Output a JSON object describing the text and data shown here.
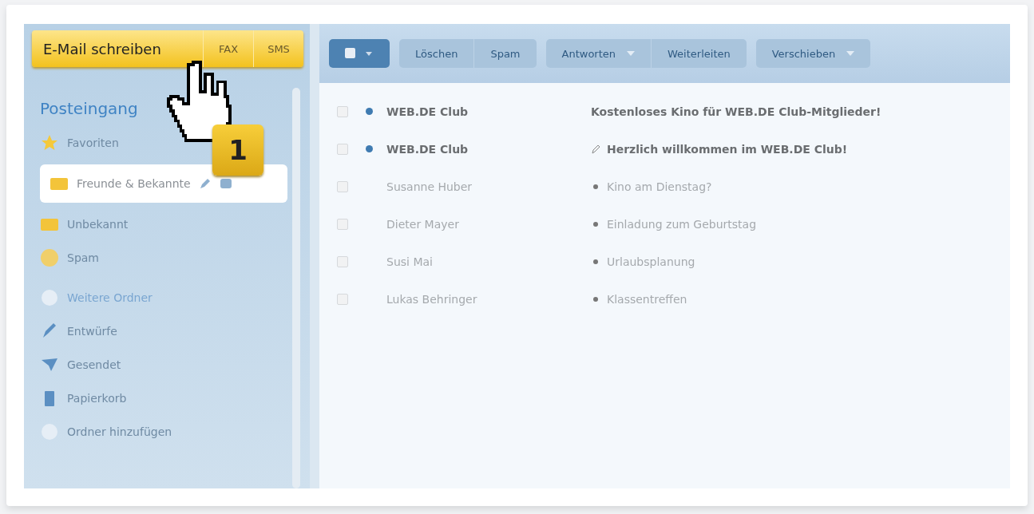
{
  "compose": {
    "buttons": [
      {
        "label": "E-Mail schreiben",
        "kind": "primary"
      },
      {
        "label": "FAX",
        "kind": "secondary"
      },
      {
        "label": "SMS",
        "kind": "secondary"
      }
    ]
  },
  "step_badge": {
    "label": "1"
  },
  "sidebar": {
    "items": [
      {
        "kind": "heading",
        "label": "Posteingang"
      },
      {
        "kind": "favorites",
        "label": "Favoriten",
        "selected": false
      },
      {
        "kind": "folder",
        "label": "Freunde & Bekannte",
        "selected": true
      },
      {
        "kind": "folder",
        "label": "Unbekannt",
        "selected": false
      },
      {
        "kind": "spam",
        "label": "Spam",
        "selected": false
      },
      {
        "kind": "group",
        "label": "Weitere Ordner"
      },
      {
        "kind": "drafts",
        "label": "Entwürfe",
        "selected": false
      },
      {
        "kind": "sent",
        "label": "Gesendet",
        "selected": false
      },
      {
        "kind": "trash",
        "label": "Papierkorb",
        "selected": false
      },
      {
        "kind": "action",
        "label": "Ordner hinzufügen"
      }
    ]
  },
  "toolbar": {
    "groups": [
      {
        "buttons": [
          {
            "label": "Löschen",
            "menu": false
          },
          {
            "label": "Spam",
            "menu": false
          }
        ]
      },
      {
        "buttons": [
          {
            "label": "Antworten",
            "menu": true
          },
          {
            "label": "Weiterleiten",
            "menu": false
          }
        ]
      },
      {
        "buttons": [
          {
            "label": "Verschieben",
            "menu": true
          }
        ]
      }
    ]
  },
  "messages": [
    {
      "sender": "WEB.DE Club",
      "subject": "Kostenloses Kino für WEB.DE Club-Mitglieder!",
      "unread": true,
      "checked": false
    },
    {
      "sender": "WEB.DE Club",
      "subject": "Herzlich willkommen im WEB.DE Club!",
      "unread": true,
      "checked": false
    },
    {
      "sender": "Susanne Huber",
      "subject": "Kino am Dienstag?",
      "unread": false,
      "checked": false
    },
    {
      "sender": "Dieter Mayer",
      "subject": "Einladung zum Geburtstag",
      "unread": false,
      "checked": false
    },
    {
      "sender": "Susi Mai",
      "subject": "Urlaubsplanung",
      "unread": false,
      "checked": false
    },
    {
      "sender": "Lukas Behringer",
      "subject": "Klassentreffen",
      "unread": false,
      "checked": false
    }
  ]
}
